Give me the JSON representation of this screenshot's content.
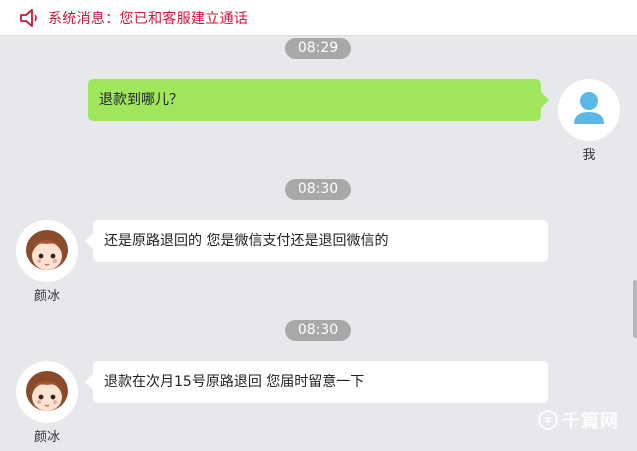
{
  "notice": {
    "text": "系统消息：您已和客服建立通话",
    "icon": "speaker-icon",
    "color": "#c8193c"
  },
  "messages": [
    {
      "time": "08:29",
      "sender": "我",
      "text": "退款到哪儿？",
      "side": "right"
    },
    {
      "time": "08:30",
      "sender": "颜冰",
      "text": "还是原路退回的 您是微信支付还是退回微信的",
      "side": "left"
    },
    {
      "time": "08:30",
      "sender": "颜冰",
      "text": "退款在次月15号原路退回 您届时留意一下",
      "side": "left"
    }
  ],
  "colors": {
    "my_bubble": "#9fe65c",
    "other_bubble": "#ffffff",
    "background": "#e7e8ec",
    "timestamp": "#a8a8a8"
  },
  "watermark": {
    "text": "千篇网"
  }
}
